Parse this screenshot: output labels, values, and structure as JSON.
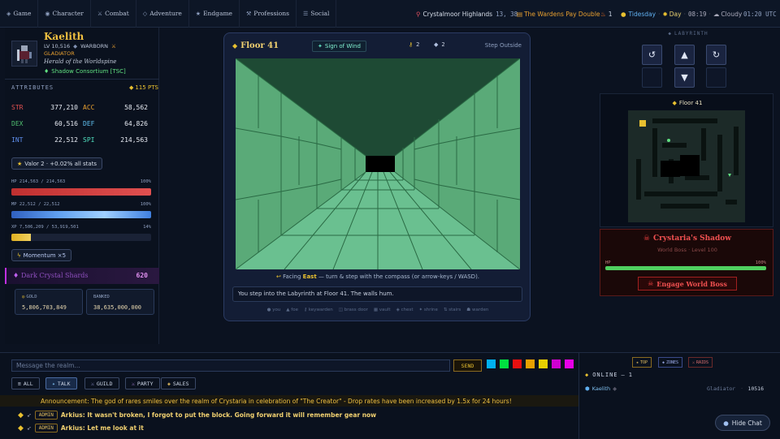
{
  "nav": {
    "items": [
      {
        "icon": "◈",
        "label": "Game"
      },
      {
        "icon": "◉",
        "label": "Character"
      },
      {
        "icon": "⚔",
        "label": "Combat"
      },
      {
        "icon": "◇",
        "label": "Adventure"
      },
      {
        "icon": "★",
        "label": "Endgame"
      },
      {
        "icon": "⚒",
        "label": "Professions"
      },
      {
        "icon": "☰",
        "label": "Social"
      }
    ],
    "location": "Crystalmoor Highlands",
    "coords": "13, 38",
    "event": "The Wardens Pay Double",
    "flame_count": "1",
    "tide": "Tidesday",
    "day": "Day",
    "clock": "08:19",
    "weather": "Cloudy",
    "utc": "01:20 UTC"
  },
  "character": {
    "name": "Kaelith",
    "level": "LV 10,516",
    "rank": "WARBORN",
    "class": "GLADIATOR",
    "title": "Herald of the Worldspine",
    "guild": "Shadow Consortium [TSC]",
    "attributes_label": "ATTRIBUTES",
    "points": "115 PTS",
    "stats": [
      {
        "k1": "STR",
        "v1": "377,210",
        "k2": "ACC",
        "v2": "58,562"
      },
      {
        "k1": "DEX",
        "v1": "60,516",
        "k2": "DEF",
        "v2": "64,826"
      },
      {
        "k1": "INT",
        "v1": "22,512",
        "k2": "SPI",
        "v2": "214,563"
      }
    ],
    "valor": "Valor 2 · +0.02% all stats",
    "hp_text": "HP 214,563 / 214,563",
    "hp_pct": "100%",
    "hp_value": 1.0,
    "mp_text": "MP 22,512 / 22,512",
    "mp_pct": "100%",
    "mp_value": 1.0,
    "xp_text": "XP 7,506,209 / 53,919,501",
    "xp_pct": "14%",
    "xp_value": 0.14,
    "momentum": "Momentum ×5",
    "shards_label": "Dark Crystal Shards",
    "shards_value": "620",
    "gold_label": "GOLD",
    "gold_value": "5,806,703,849",
    "banked_label": "BANKED",
    "banked_value": "38,635,000,000"
  },
  "dungeon": {
    "floor": "Floor 41",
    "sign": "Sign of Wind",
    "keys": "2",
    "gems": "2",
    "step_outside": "Step Outside",
    "facing_prefix": "Facing",
    "facing": "East",
    "facing_suffix": "— turn & step with the compass (or arrow-keys / WASD).",
    "log": "You step into the Labyrinth at Floor 41. The walls hum.",
    "legend": [
      "you",
      "foe",
      "keywarden",
      "brass door",
      "vault",
      "chest",
      "shrine",
      "stairs",
      "warden"
    ]
  },
  "labyrinth": {
    "title": "LABYRINTH",
    "map_floor": "Floor 41",
    "boss_name": "Crystaria's Shadow",
    "boss_sub": "World Boss · Level 100",
    "boss_hp_label": "HP",
    "boss_hp_pct": "100%",
    "boss_hp_value": 1.0,
    "engage": "Engage World Boss"
  },
  "chat": {
    "placeholder": "Message the realm...",
    "send": "SEND",
    "colors": [
      "#00b0f0",
      "#00e040",
      "#e81010",
      "#e8a000",
      "#e8d000",
      "#d000d0",
      "#e800e8"
    ],
    "tabs": [
      {
        "icon": "≡",
        "label": "ALL"
      },
      {
        "icon": "✦",
        "label": "TALK"
      },
      {
        "icon": "⚔",
        "label": "GUILD"
      },
      {
        "icon": "⚔",
        "label": "PARTY"
      },
      {
        "icon": "◈",
        "label": "SALES"
      }
    ],
    "announcement": "Announcement: The god of rares smiles over the realm of Crystaria in celebration of \"The Creator\" - Drop rates have been increased by 1.5x for 24 hours!",
    "messages": [
      {
        "badge": "ADMIN",
        "text": "Arkius: It wasn't broken, I forgot to put the block. Going forward it will remember gear now"
      },
      {
        "badge": "ADMIN",
        "text": "Arkius: Let me look at it"
      }
    ],
    "filters": [
      "TOP",
      "ZONES",
      "RAIDS"
    ],
    "online_label": "ONLINE",
    "online_count": "1",
    "online_user": "Kaelith",
    "online_class": "Gladiator",
    "online_level": "10516",
    "hide_chat": "Hide Chat"
  }
}
